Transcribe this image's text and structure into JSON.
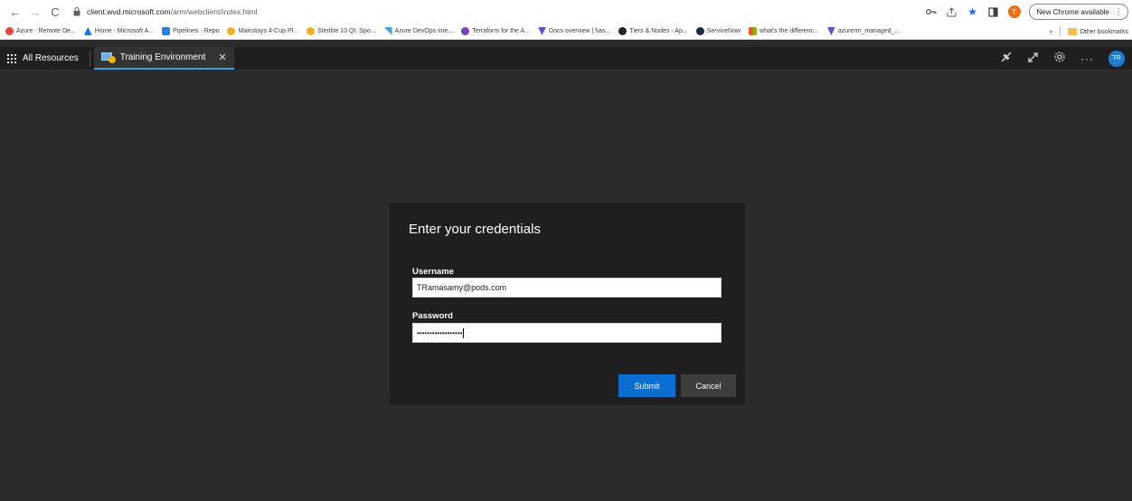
{
  "browser": {
    "url_host": "client.wvd.microsoft.com",
    "url_path": "/arm/webclient/index.html",
    "update_label": "New Chrome available",
    "profile_initial": "T"
  },
  "bookmarks": {
    "items": [
      {
        "label": "Azure - Remote De...",
        "color": "#e8453c"
      },
      {
        "label": "Home - Microsoft A...",
        "color": "#1a73e8"
      },
      {
        "label": "Pipelines - Repo",
        "color": "#2b7fd4"
      },
      {
        "label": "Mainstays 4-Cup Pl...",
        "color": "#f2b01e"
      },
      {
        "label": "Sterilite 10 Qt. Spo...",
        "color": "#f2b01e"
      },
      {
        "label": "Azure DevOps inte...",
        "color": "#4aa3df"
      },
      {
        "label": "Terraform for the A...",
        "color": "#7b42bc"
      },
      {
        "label": "Docs overview | has...",
        "color": "#6a4fc7"
      },
      {
        "label": "Tiers & Nodes - Ap...",
        "color": "#222222"
      },
      {
        "label": "ServiceNow",
        "color": "#1f2a44"
      },
      {
        "label": "what's the differenc...",
        "color": "#f25022"
      },
      {
        "label": "azurerm_managed_...",
        "color": "#6a4fc7"
      }
    ],
    "more": "»",
    "other_label": "Other bookmarks"
  },
  "app_bar": {
    "all_resources": "All Resources",
    "tab_label": "Training Environment",
    "avatar_initials": "TR"
  },
  "dialog": {
    "title": "Enter your credentials",
    "username_label": "Username",
    "username_value": "TRamasamy@pods.com",
    "password_label": "Password",
    "password_mask": "••••••••••••••••••",
    "submit_label": "Submit",
    "cancel_label": "Cancel"
  },
  "colors": {
    "accent": "#0d6ed1",
    "tab_underline": "#3b9ee8",
    "background": "#2b2b2b",
    "dialog_bg": "#1f1f1f"
  }
}
